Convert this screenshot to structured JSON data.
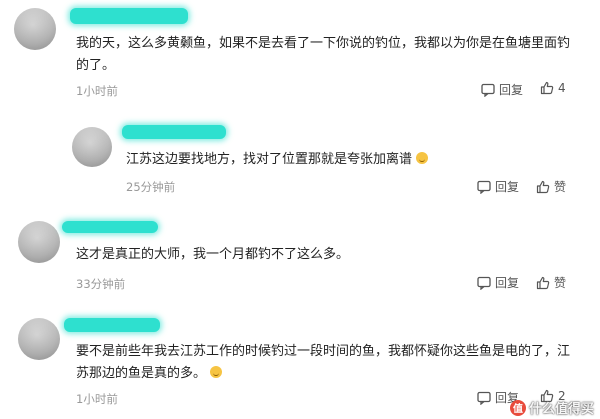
{
  "comments": [
    {
      "text_line1": "我的天，这么多黄颡鱼，如果不是去看了一下你说的钓位，我都以为你是在鱼塘里面钓",
      "text_line2": "的了。",
      "time": "1小时前",
      "reply_label": "回复",
      "like_count": "4"
    },
    {
      "text": "江苏这边要找地方，找对了位置那就是夸张加离谱",
      "time": "25分钟前",
      "reply_label": "回复",
      "like_label": "赞"
    },
    {
      "text": "这才是真正的大师，我一个月都钓不了这么多。",
      "time": "33分钟前",
      "reply_label": "回复",
      "like_label": "赞"
    },
    {
      "text_line1": "要不是前些年我去江苏工作的时候钓过一段时间的鱼，我都怀疑你这些鱼是电的了，江",
      "text_line2": "苏那边的鱼是真的多。",
      "time": "1小时前",
      "reply_label": "回复",
      "like_count": "2"
    }
  ],
  "watermark": {
    "badge": "值",
    "text": "什么值得买"
  },
  "colors": {
    "name_mask": "#2ee0cf",
    "text": "#222222",
    "meta": "#999999"
  }
}
